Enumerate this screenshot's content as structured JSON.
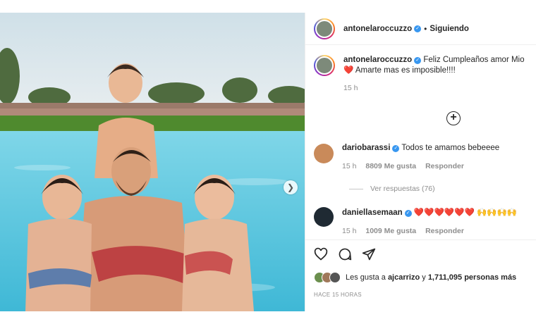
{
  "post": {
    "author": "antonelaroccuzzo",
    "follow_status": "Siguiendo",
    "separator": "•",
    "caption_text": "Feliz Cumpleaños amor Mio❤️ Amarte mas es imposible!!!!",
    "caption_time": "15 h"
  },
  "comments": [
    {
      "user": "dariobarassi",
      "text": "Todos te amamos bebeeee",
      "time": "15 h",
      "likes": "8809 Me gusta",
      "reply": "Responder",
      "view_replies": "Ver respuestas (76)"
    },
    {
      "user": "daniellasemaan",
      "text": "❤️❤️❤️❤️❤️❤️ 🙌🙌🙌🙌",
      "time": "15 h",
      "likes": "1009 Me gusta",
      "reply": "Responder"
    }
  ],
  "likes_summary": {
    "prefix": "Les gusta a",
    "user": "ajcarrizo",
    "connector": "y",
    "count": "1,711,095 personas más"
  },
  "timestamp": "HACE 15 HORAS",
  "icons": [
    "heart-icon",
    "comment-icon",
    "share-icon",
    "add-comment-icon",
    "next-arrow-icon",
    "verified-icon"
  ],
  "colors": {
    "verified": "#3897f0",
    "muted": "#8e8e8e",
    "text": "#262626"
  }
}
